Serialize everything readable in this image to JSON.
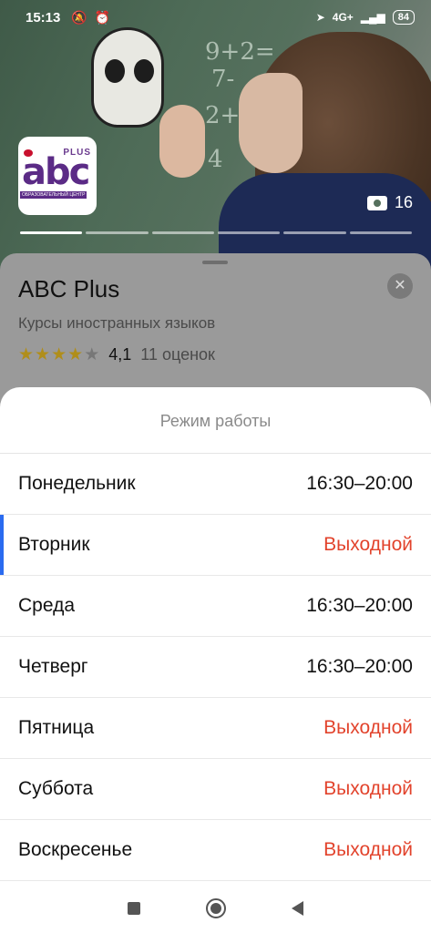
{
  "status_bar": {
    "time": "15:13",
    "network": "4G+",
    "battery": "84"
  },
  "photo": {
    "count": "16",
    "gallery_segments": 6,
    "chalk": [
      "9+2=",
      "2+2",
      "7-",
      "4"
    ]
  },
  "logo": {
    "plus": "PLUS",
    "abc": "abc",
    "subtitle": "ОБРАЗОВАТЕЛЬНЫЙ ЦЕНТР"
  },
  "card": {
    "title": "ABC Plus",
    "subtitle": "Курсы иностранных языков",
    "rating_value": "4,1",
    "rating_count": "11 оценок",
    "stars": 4
  },
  "schedule": {
    "title": "Режим работы",
    "days": [
      {
        "name": "Понедельник",
        "hours": "16:30–20:00",
        "closed": false,
        "today": false
      },
      {
        "name": "Вторник",
        "hours": "Выходной",
        "closed": true,
        "today": true
      },
      {
        "name": "Среда",
        "hours": "16:30–20:00",
        "closed": false,
        "today": false
      },
      {
        "name": "Четверг",
        "hours": "16:30–20:00",
        "closed": false,
        "today": false
      },
      {
        "name": "Пятница",
        "hours": "Выходной",
        "closed": true,
        "today": false
      },
      {
        "name": "Суббота",
        "hours": "Выходной",
        "closed": true,
        "today": false
      },
      {
        "name": "Воскресенье",
        "hours": "Выходной",
        "closed": true,
        "today": false
      }
    ]
  },
  "colors": {
    "closed": "#e2432c",
    "today_marker": "#2a6bf0",
    "star": "#b08e1a"
  }
}
